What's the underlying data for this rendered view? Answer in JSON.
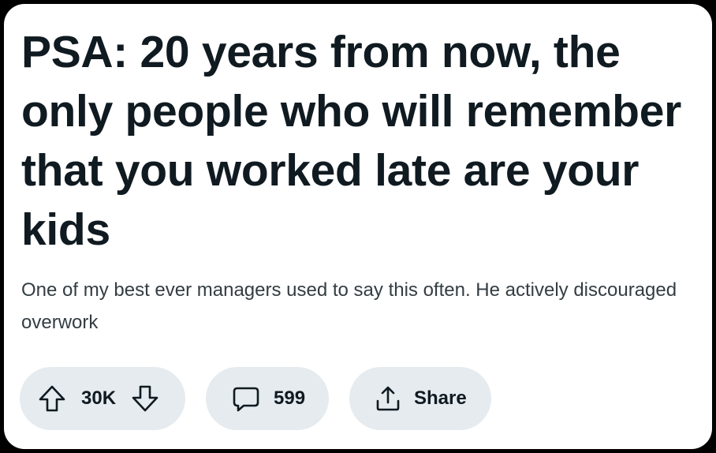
{
  "post": {
    "title": "PSA: 20 years from now, the only people who will remember that you worked late are your kids",
    "body": "One of my best ever managers used to say this often. He actively discouraged overwork"
  },
  "actions": {
    "score": "30K",
    "comments": "599",
    "share_label": "Share"
  },
  "icons": {
    "upvote": "arrow-up-icon",
    "downvote": "arrow-down-icon",
    "comment": "speech-bubble-icon",
    "share": "share-icon"
  },
  "colors": {
    "text": "#101a21",
    "body_text": "#333d42",
    "pill_background": "#e5ebee",
    "card_background": "#ffffff",
    "frame": "#000000"
  }
}
